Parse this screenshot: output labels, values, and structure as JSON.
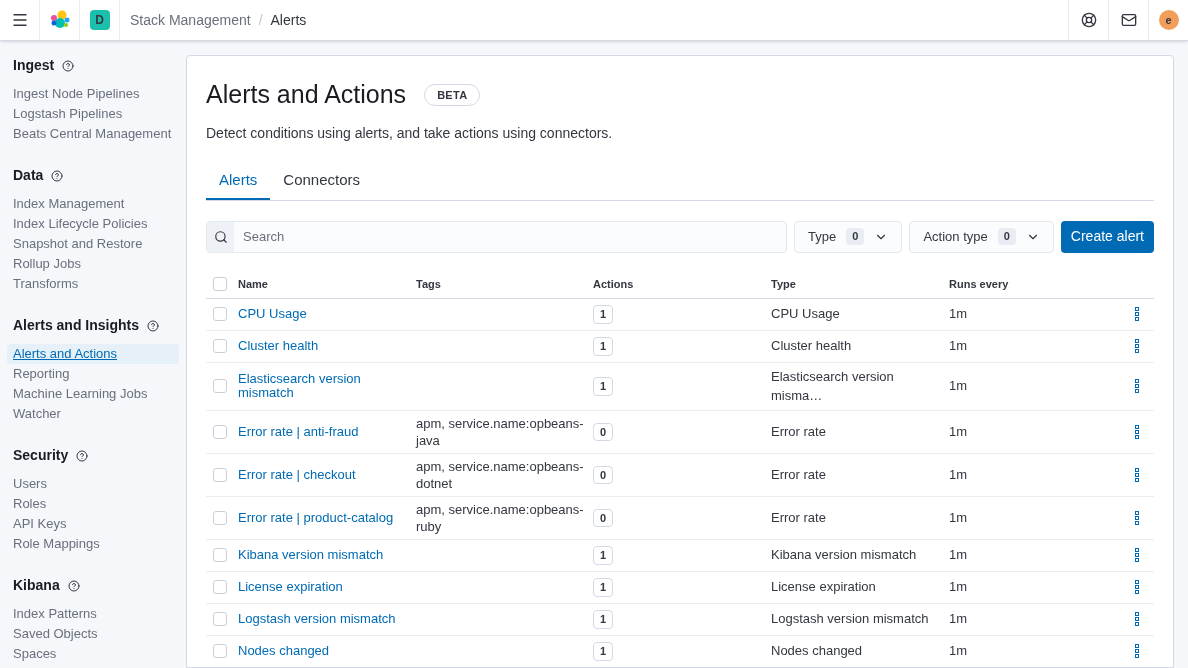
{
  "header": {
    "space_badge": "D",
    "breadcrumbs": [
      "Stack Management",
      "Alerts"
    ],
    "breadcrumb_separator": "/",
    "avatar": "e"
  },
  "sidebar": {
    "sections": [
      {
        "title": "Ingest",
        "items": [
          {
            "label": "Ingest Node Pipelines",
            "selected": false
          },
          {
            "label": "Logstash Pipelines",
            "selected": false
          },
          {
            "label": "Beats Central Management",
            "selected": false
          }
        ]
      },
      {
        "title": "Data",
        "items": [
          {
            "label": "Index Management",
            "selected": false
          },
          {
            "label": "Index Lifecycle Policies",
            "selected": false
          },
          {
            "label": "Snapshot and Restore",
            "selected": false
          },
          {
            "label": "Rollup Jobs",
            "selected": false
          },
          {
            "label": "Transforms",
            "selected": false
          }
        ]
      },
      {
        "title": "Alerts and Insights",
        "items": [
          {
            "label": "Alerts and Actions",
            "selected": true
          },
          {
            "label": "Reporting",
            "selected": false
          },
          {
            "label": "Machine Learning Jobs",
            "selected": false
          },
          {
            "label": "Watcher",
            "selected": false
          }
        ]
      },
      {
        "title": "Security",
        "items": [
          {
            "label": "Users",
            "selected": false
          },
          {
            "label": "Roles",
            "selected": false
          },
          {
            "label": "API Keys",
            "selected": false
          },
          {
            "label": "Role Mappings",
            "selected": false
          }
        ]
      },
      {
        "title": "Kibana",
        "items": [
          {
            "label": "Index Patterns",
            "selected": false
          },
          {
            "label": "Saved Objects",
            "selected": false
          },
          {
            "label": "Spaces",
            "selected": false
          }
        ]
      }
    ]
  },
  "page": {
    "title": "Alerts and Actions",
    "badge": "BETA",
    "description": "Detect conditions using alerts, and take actions using connectors."
  },
  "tabs": [
    {
      "label": "Alerts",
      "selected": true
    },
    {
      "label": "Connectors",
      "selected": false
    }
  ],
  "toolbar": {
    "search": {
      "placeholder": "Search"
    },
    "filters": [
      {
        "label": "Type",
        "count": "0"
      },
      {
        "label": "Action type",
        "count": "0"
      }
    ],
    "create_button": "Create alert"
  },
  "table": {
    "select_all": {
      "checked": false
    },
    "columns": [
      "Name",
      "Tags",
      "Actions",
      "Type",
      "Runs every"
    ],
    "rows": [
      {
        "name": "CPU Usage",
        "tags": "",
        "actions": "1",
        "type": "CPU Usage",
        "interval": "1m",
        "checked": false
      },
      {
        "name": "Cluster health",
        "tags": "",
        "actions": "1",
        "type": "Cluster health",
        "interval": "1m",
        "checked": false
      },
      {
        "name": "Elasticsearch version mismatch",
        "tags": "",
        "actions": "1",
        "type": "Elasticsearch version misma…",
        "interval": "1m",
        "checked": false
      },
      {
        "name": "Error rate | anti-fraud",
        "tags": "apm, service.name:opbeans-java",
        "actions": "0",
        "type": "Error rate",
        "interval": "1m",
        "checked": false
      },
      {
        "name": "Error rate | checkout",
        "tags": "apm, service.name:opbeans-dotnet",
        "actions": "0",
        "type": "Error rate",
        "interval": "1m",
        "checked": false
      },
      {
        "name": "Error rate | product-catalog",
        "tags": "apm, service.name:opbeans-ruby",
        "actions": "0",
        "type": "Error rate",
        "interval": "1m",
        "checked": false
      },
      {
        "name": "Kibana version mismatch",
        "tags": "",
        "actions": "1",
        "type": "Kibana version mismatch",
        "interval": "1m",
        "checked": false
      },
      {
        "name": "License expiration",
        "tags": "",
        "actions": "1",
        "type": "License expiration",
        "interval": "1m",
        "checked": false
      },
      {
        "name": "Logstash version mismatch",
        "tags": "",
        "actions": "1",
        "type": "Logstash version mismatch",
        "interval": "1m",
        "checked": false
      },
      {
        "name": "Nodes changed",
        "tags": "",
        "actions": "1",
        "type": "Nodes changed",
        "interval": "1m",
        "checked": false
      }
    ]
  }
}
